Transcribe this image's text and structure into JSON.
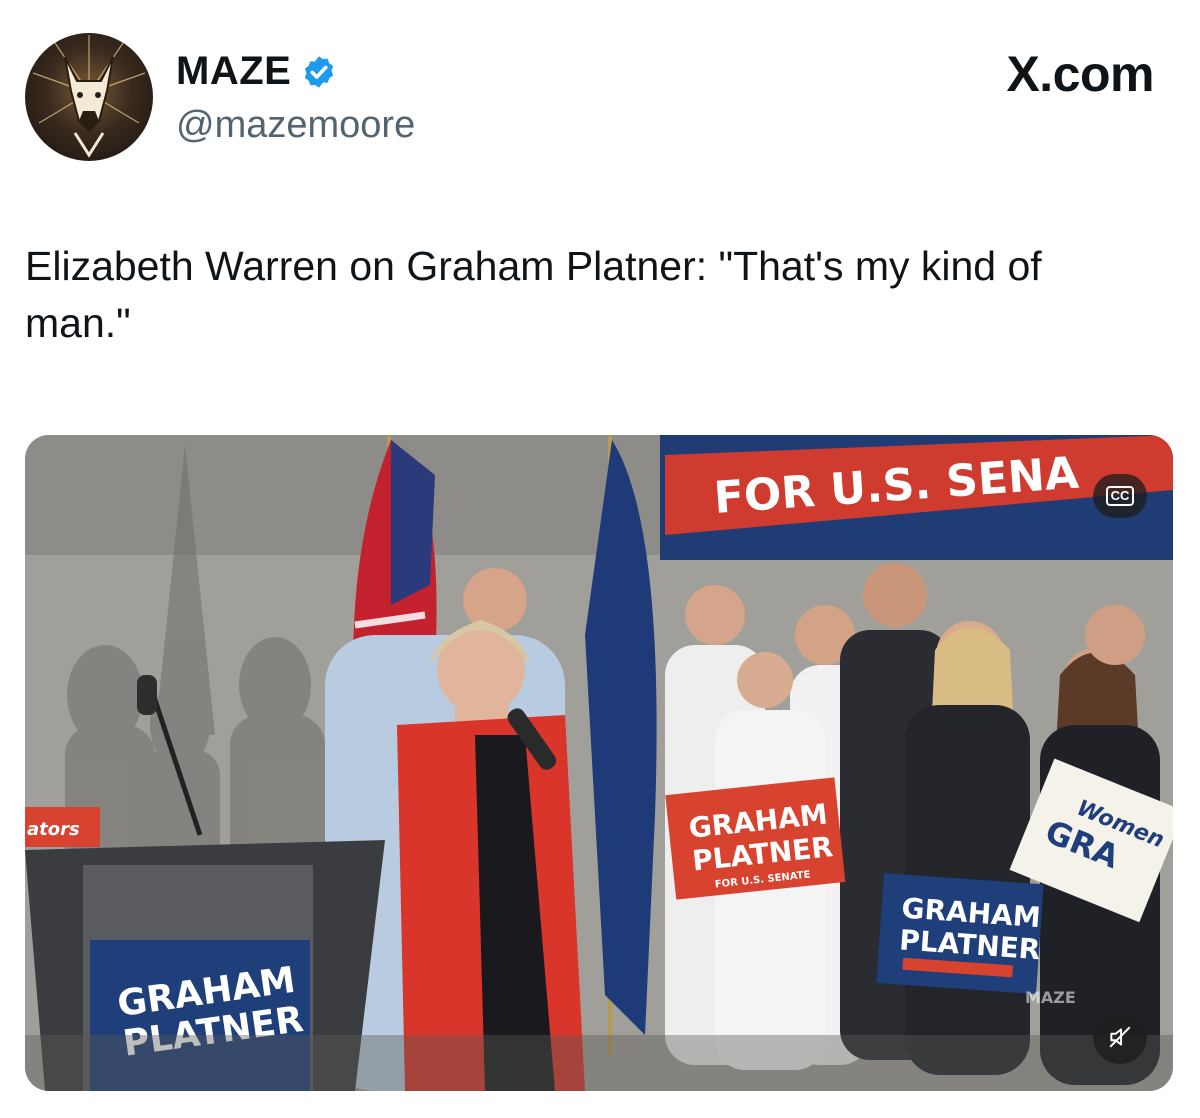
{
  "author": {
    "display_name": "MAZE",
    "handle": "@mazemoore",
    "verified": true,
    "avatar_icon": "doberman-logo-icon"
  },
  "brand": {
    "label": "X.com"
  },
  "tweet": {
    "text": "Elizabeth Warren on Graham Platner: \"That's my kind of man.\""
  },
  "media": {
    "banner_text": "FOR U.S. SENA",
    "sign_text_line1": "GRAHAM",
    "sign_text_line2": "PLATNER",
    "sign_text_line3": "FOR U.S. SENATE",
    "sign_fragment_left": "ators",
    "sign_women_fragment": "Women",
    "sign_women_fragment2": "GRA",
    "watermark": "MAZE",
    "cc_label": "CC",
    "cc_icon": "closed-captions-icon",
    "mute_icon": "speaker-muted-icon"
  },
  "colors": {
    "verified_blue": "#1d9bf0",
    "handle_gray": "#536471",
    "sign_navy": "#1f3f7a",
    "sign_red": "#d8432f",
    "jacket_red": "#d9352b"
  }
}
